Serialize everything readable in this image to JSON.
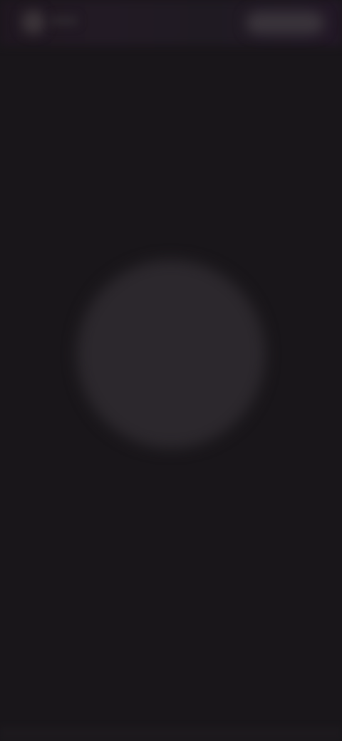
{
  "screen": {
    "background_color": "#19161a",
    "top_bar_color": "#221a24",
    "placeholder_color": "#2c282d"
  },
  "header": {
    "left_icon": "avatar-icon",
    "right_control": "blurred-pill"
  },
  "main": {
    "center_element": "blurred-circle"
  }
}
